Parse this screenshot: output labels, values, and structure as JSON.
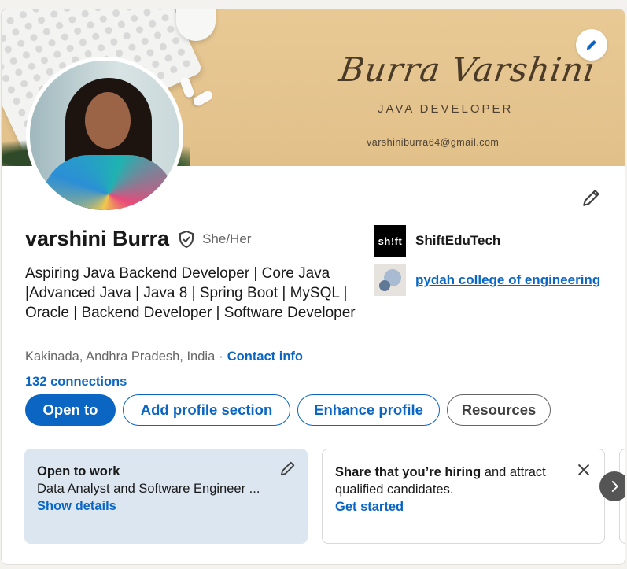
{
  "banner": {
    "name": "Burra Varshini",
    "role": "JAVA DEVELOPER",
    "email": "varshiniburra64@gmail.com"
  },
  "profile": {
    "name": "varshini Burra",
    "pronouns": "She/Her",
    "headline": "Aspiring Java Backend Developer | Core Java |Advanced Java | Java 8 | Spring Boot | MySQL | Oracle | Backend Developer | Software Developer",
    "location": "Kakinada, Andhra Pradesh, India",
    "separator": "·",
    "contact_info": "Contact info",
    "connections": "132 connections"
  },
  "orgs": [
    {
      "logo_text": "sh!ft",
      "name": "ShiftEduTech"
    },
    {
      "name": "pydah college of engineering"
    }
  ],
  "actions": {
    "open_to": "Open to",
    "add_section": "Add profile section",
    "enhance": "Enhance profile",
    "resources": "Resources"
  },
  "open_to_work": {
    "title": "Open to work",
    "description": "Data Analyst and Software Engineer ...",
    "link": "Show details"
  },
  "hiring": {
    "title_bold": "Share that you’re hiring",
    "title_rest": " and attract qualified candidates.",
    "link": "Get started"
  },
  "colors": {
    "accent": "#0a66c2",
    "banner": "#e8c994",
    "open_to_work_bg": "#dce6f1"
  },
  "icons": [
    "pencil-icon",
    "verified-shield-icon",
    "close-icon",
    "chevron-right-icon"
  ]
}
